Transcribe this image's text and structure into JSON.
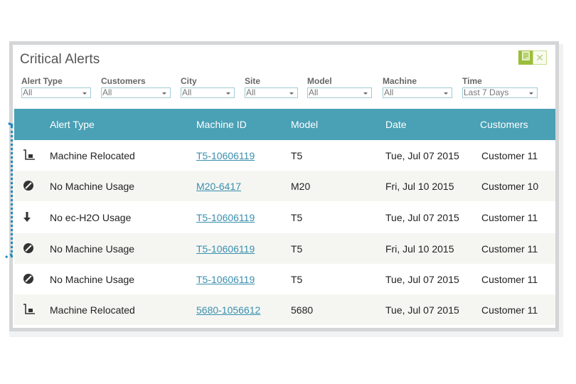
{
  "widget": {
    "title": "Critical Alerts",
    "actions": [
      {
        "name": "export",
        "icon": "document-icon",
        "color": "#9bbd3c"
      },
      {
        "name": "close",
        "icon": "close-icon",
        "glyph": "✕"
      }
    ]
  },
  "filters": [
    {
      "label": "Alert Type",
      "value": "All"
    },
    {
      "label": "Customers",
      "value": "All"
    },
    {
      "label": "City",
      "value": "All"
    },
    {
      "label": "Site",
      "value": "All"
    },
    {
      "label": "Model",
      "value": "All"
    },
    {
      "label": "Machine",
      "value": "All"
    },
    {
      "label": "Time",
      "value": "Last 7 Days"
    }
  ],
  "table": {
    "header_color": "#4aa0b5",
    "columns": [
      "Alert Type",
      "Machine ID",
      "Model",
      "Date",
      "Customers"
    ],
    "rows": [
      {
        "icon": "relocate-cart-icon",
        "alert_type": "Machine Relocated",
        "machine_id": "T5-10606119",
        "model": "T5",
        "date": "Tue, Jul 07 2015",
        "customer": "Customer 11"
      },
      {
        "icon": "no-usage-icon",
        "alert_type": "No Machine Usage",
        "machine_id": "M20-6417",
        "model": "M20",
        "date": "Fri, Jul 10 2015",
        "customer": "Customer 10"
      },
      {
        "icon": "arrow-down-icon",
        "alert_type": "No ec-H2O Usage",
        "machine_id": "T5-10606119",
        "model": "T5",
        "date": "Tue, Jul 07 2015",
        "customer": "Customer 11"
      },
      {
        "icon": "no-usage-icon",
        "alert_type": "No Machine Usage",
        "machine_id": "T5-10606119",
        "model": "T5",
        "date": "Fri, Jul 10 2015",
        "customer": "Customer 11"
      },
      {
        "icon": "no-usage-icon",
        "alert_type": "No Machine Usage",
        "machine_id": "T5-10606119",
        "model": "T5",
        "date": "Tue, Jul 07 2015",
        "customer": "Customer 11"
      },
      {
        "icon": "relocate-cart-icon",
        "alert_type": "Machine Relocated",
        "machine_id": "5680-1056612",
        "model": "5680",
        "date": "Tue, Jul 07 2015",
        "customer": "Customer 11"
      }
    ]
  }
}
